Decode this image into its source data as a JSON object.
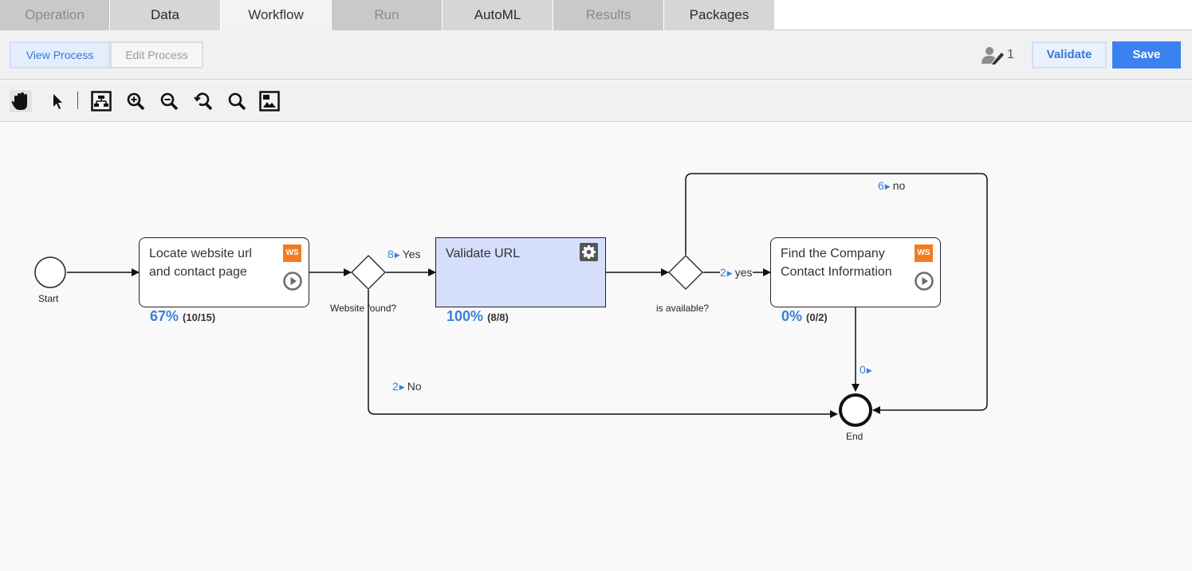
{
  "tabs": [
    {
      "label": "Operation",
      "state": "disabled"
    },
    {
      "label": "Data",
      "state": "normal"
    },
    {
      "label": "Workflow",
      "state": "active"
    },
    {
      "label": "Run",
      "state": "disabled"
    },
    {
      "label": "AutoML",
      "state": "normal"
    },
    {
      "label": "Results",
      "state": "disabled"
    },
    {
      "label": "Packages",
      "state": "normal"
    }
  ],
  "mode": {
    "view_label": "View Process",
    "edit_label": "Edit Process",
    "active": "view"
  },
  "editors": {
    "icon": "user-edit-icon",
    "count": "1"
  },
  "actions": {
    "validate_label": "Validate",
    "save_label": "Save"
  },
  "toolbar": {
    "tools": [
      "hand-pan-icon",
      "pointer-select-icon",
      "auto-layout-icon",
      "zoom-in-icon",
      "zoom-out-icon",
      "zoom-reset-icon",
      "zoom-fit-icon",
      "overview-map-icon"
    ]
  },
  "process": {
    "start": {
      "label": "Start"
    },
    "end": {
      "label": "End"
    },
    "tasks": [
      {
        "title_line1": "Locate website url",
        "title_line2": "and contact page",
        "badge": "WS",
        "percent": "67%",
        "ratio": "(10/15)",
        "progress": 0.67
      },
      {
        "title_line1": "Validate URL",
        "title_line2": "",
        "badge": "gear-icon",
        "percent": "100%",
        "ratio": "(8/8)",
        "progress": 1.0
      },
      {
        "title_line1": "Find the Company",
        "title_line2": "Contact Information",
        "badge": "WS",
        "percent": "0%",
        "ratio": "(0/2)",
        "progress": 0.0
      }
    ],
    "gateways": [
      {
        "label": "Website found?"
      },
      {
        "label": "is available?"
      }
    ],
    "flows": [
      {
        "count": "8",
        "label": "Yes"
      },
      {
        "count": "2",
        "label": "No"
      },
      {
        "count": "2",
        "label": "yes"
      },
      {
        "count": "6",
        "label": "no"
      },
      {
        "count": "0",
        "label": ""
      }
    ]
  },
  "colors": {
    "accent": "#3a82ef",
    "progress_text": "#3a7fd9",
    "ws_badge": "#f47a20",
    "selected_task_fill": "#d5defa"
  }
}
